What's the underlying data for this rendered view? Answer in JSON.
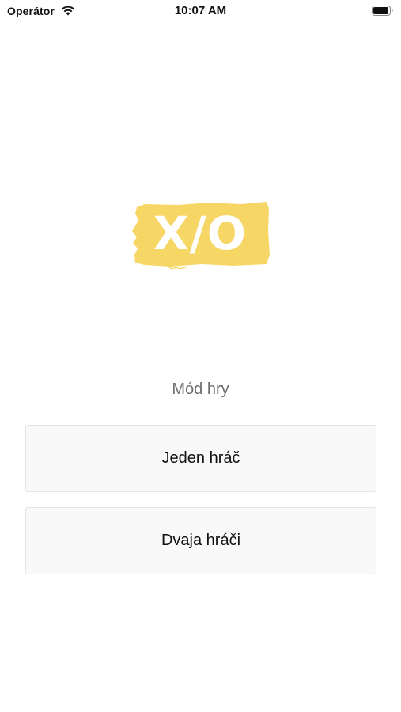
{
  "status_bar": {
    "carrier": "Operátor",
    "time": "10:07 AM",
    "wifi_icon": "wifi-icon",
    "battery_icon": "battery-icon",
    "battery_level": 0.95
  },
  "logo": {
    "text": "X/O",
    "background_color": "#F6D765",
    "text_color": "#FFFFFF"
  },
  "mode": {
    "label": "Mód hry",
    "buttons": [
      {
        "label": "Jeden hráč"
      },
      {
        "label": "Dvaja hráči"
      }
    ]
  }
}
